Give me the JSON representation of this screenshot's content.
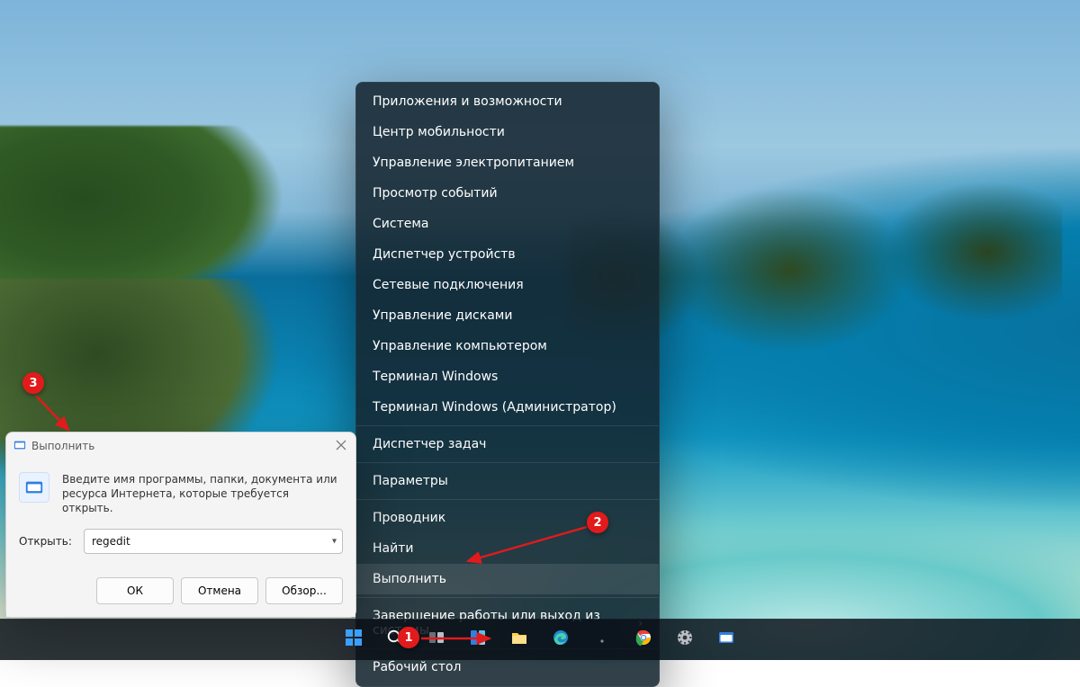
{
  "context_menu": {
    "items": [
      {
        "label": "Приложения и возможности",
        "hover": false,
        "submenu": false
      },
      {
        "label": "Центр мобильности",
        "hover": false,
        "submenu": false
      },
      {
        "label": "Управление электропитанием",
        "hover": false,
        "submenu": false
      },
      {
        "label": "Просмотр событий",
        "hover": false,
        "submenu": false
      },
      {
        "label": "Система",
        "hover": false,
        "submenu": false
      },
      {
        "label": "Диспетчер устройств",
        "hover": false,
        "submenu": false
      },
      {
        "label": "Сетевые подключения",
        "hover": false,
        "submenu": false
      },
      {
        "label": "Управление дисками",
        "hover": false,
        "submenu": false
      },
      {
        "label": "Управление компьютером",
        "hover": false,
        "submenu": false
      },
      {
        "label": "Терминал Windows",
        "hover": false,
        "submenu": false
      },
      {
        "label": "Терминал Windows (Администратор)",
        "hover": false,
        "submenu": false
      },
      {
        "sep": true
      },
      {
        "label": "Диспетчер задач",
        "hover": false,
        "submenu": false
      },
      {
        "sep": true
      },
      {
        "label": "Параметры",
        "hover": false,
        "submenu": false
      },
      {
        "sep": true
      },
      {
        "label": "Проводник",
        "hover": false,
        "submenu": false
      },
      {
        "label": "Найти",
        "hover": false,
        "submenu": false
      },
      {
        "label": "Выполнить",
        "hover": true,
        "submenu": false
      },
      {
        "sep": true
      },
      {
        "label": "Завершение работы или выход из системы",
        "hover": false,
        "submenu": true
      },
      {
        "sep": true
      },
      {
        "label": "Рабочий стол",
        "hover": false,
        "submenu": false
      }
    ]
  },
  "run_dialog": {
    "title": "Выполнить",
    "description": "Введите имя программы, папки, документа или ресурса Интернета, которые требуется открыть.",
    "open_label": "Открыть:",
    "open_value": "regedit",
    "buttons": {
      "ok": "ОК",
      "cancel": "Отмена",
      "browse": "Обзор..."
    }
  },
  "taskbar": {
    "items": [
      {
        "name": "start",
        "icon": "start"
      },
      {
        "name": "search",
        "icon": "search"
      },
      {
        "name": "task-view",
        "icon": "taskview"
      },
      {
        "name": "widgets",
        "icon": "widgets"
      },
      {
        "name": "file-explorer",
        "icon": "explorer"
      },
      {
        "name": "edge",
        "icon": "edge"
      },
      {
        "name": "app-1",
        "icon": "dot"
      },
      {
        "name": "chrome",
        "icon": "chrome"
      },
      {
        "name": "settings",
        "icon": "gear"
      },
      {
        "name": "run",
        "icon": "run"
      }
    ]
  },
  "callouts": {
    "c1": "1",
    "c2": "2",
    "c3": "3"
  }
}
